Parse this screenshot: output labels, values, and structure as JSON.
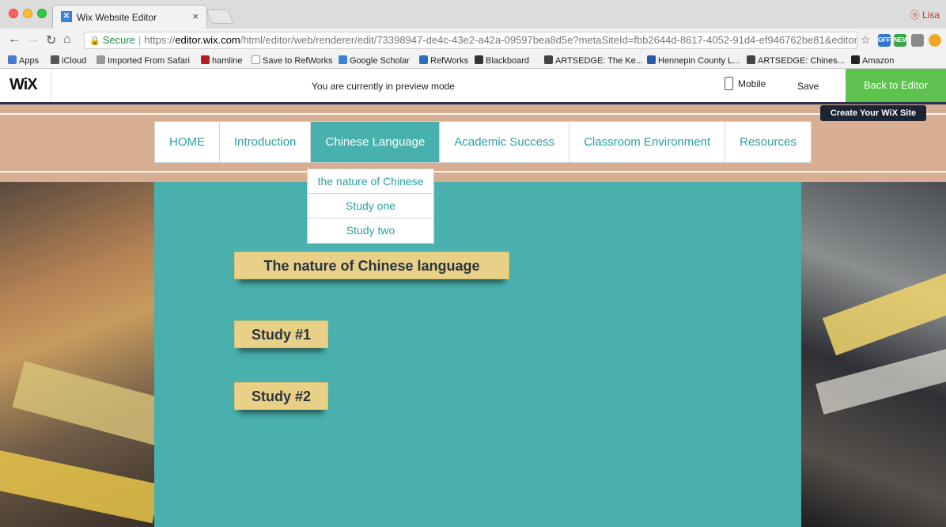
{
  "browser": {
    "tab_title": "Wix Website Editor",
    "tab_close": "×",
    "profile_name": "Lisa",
    "url_secure_label": "Secure",
    "url_scheme": "https://",
    "url_host": "editor.wix.com",
    "url_path": "/html/editor/web/renderer/edit/73398947-de4c-43e2-a42a-09597bea8d5e?metaSiteId=fbb2644d-8617-4052-91d4-ef946762be81&editor...",
    "bookmarks": [
      {
        "label": "Apps",
        "color": "#4a7bd0"
      },
      {
        "label": "iCloud",
        "color": "#555555"
      },
      {
        "label": "Imported From Safari",
        "color": "#9a9a9a"
      },
      {
        "label": "hamline",
        "color": "#b51c24"
      },
      {
        "label": "Save to RefWorks",
        "color": "#c9c9c9"
      },
      {
        "label": "Google Scholar",
        "color": "#3b82d6"
      },
      {
        "label": "RefWorks",
        "color": "#2d6fbf"
      },
      {
        "label": "Blackboard",
        "color": "#333333"
      },
      {
        "label": "ARTSEDGE: The Ke...",
        "color": "#444444"
      },
      {
        "label": "Hennepin County L...",
        "color": "#2a5aa8"
      },
      {
        "label": "ARTSEDGE: Chines...",
        "color": "#444444"
      },
      {
        "label": "Amazon",
        "color": "#222222"
      }
    ]
  },
  "wix": {
    "logo": "WiX",
    "preview_message": "You are currently in preview mode",
    "mobile_label": "Mobile",
    "save_label": "Save",
    "back_label": "Back to Editor",
    "tooltip": "Create Your WiX Site",
    "accent_color": "#5dc24e"
  },
  "site": {
    "menu": [
      {
        "label": "HOME",
        "active": false
      },
      {
        "label": "Introduction",
        "active": false
      },
      {
        "label": "Chinese Language",
        "active": true
      },
      {
        "label": "Academic Success",
        "active": false
      },
      {
        "label": "Classroom Environment",
        "active": false
      },
      {
        "label": "Resources",
        "active": false
      }
    ],
    "submenu": [
      "the nature of Chinese",
      "Study one",
      "Study two"
    ],
    "notes": {
      "nature": "The nature of Chinese language",
      "study1": "Study #1",
      "study2": "Study #2"
    },
    "colors": {
      "teal": "#49b0ad",
      "header_band": "#d7ae91",
      "note": "#e8d187",
      "menu_text": "#2aa1a1"
    }
  }
}
